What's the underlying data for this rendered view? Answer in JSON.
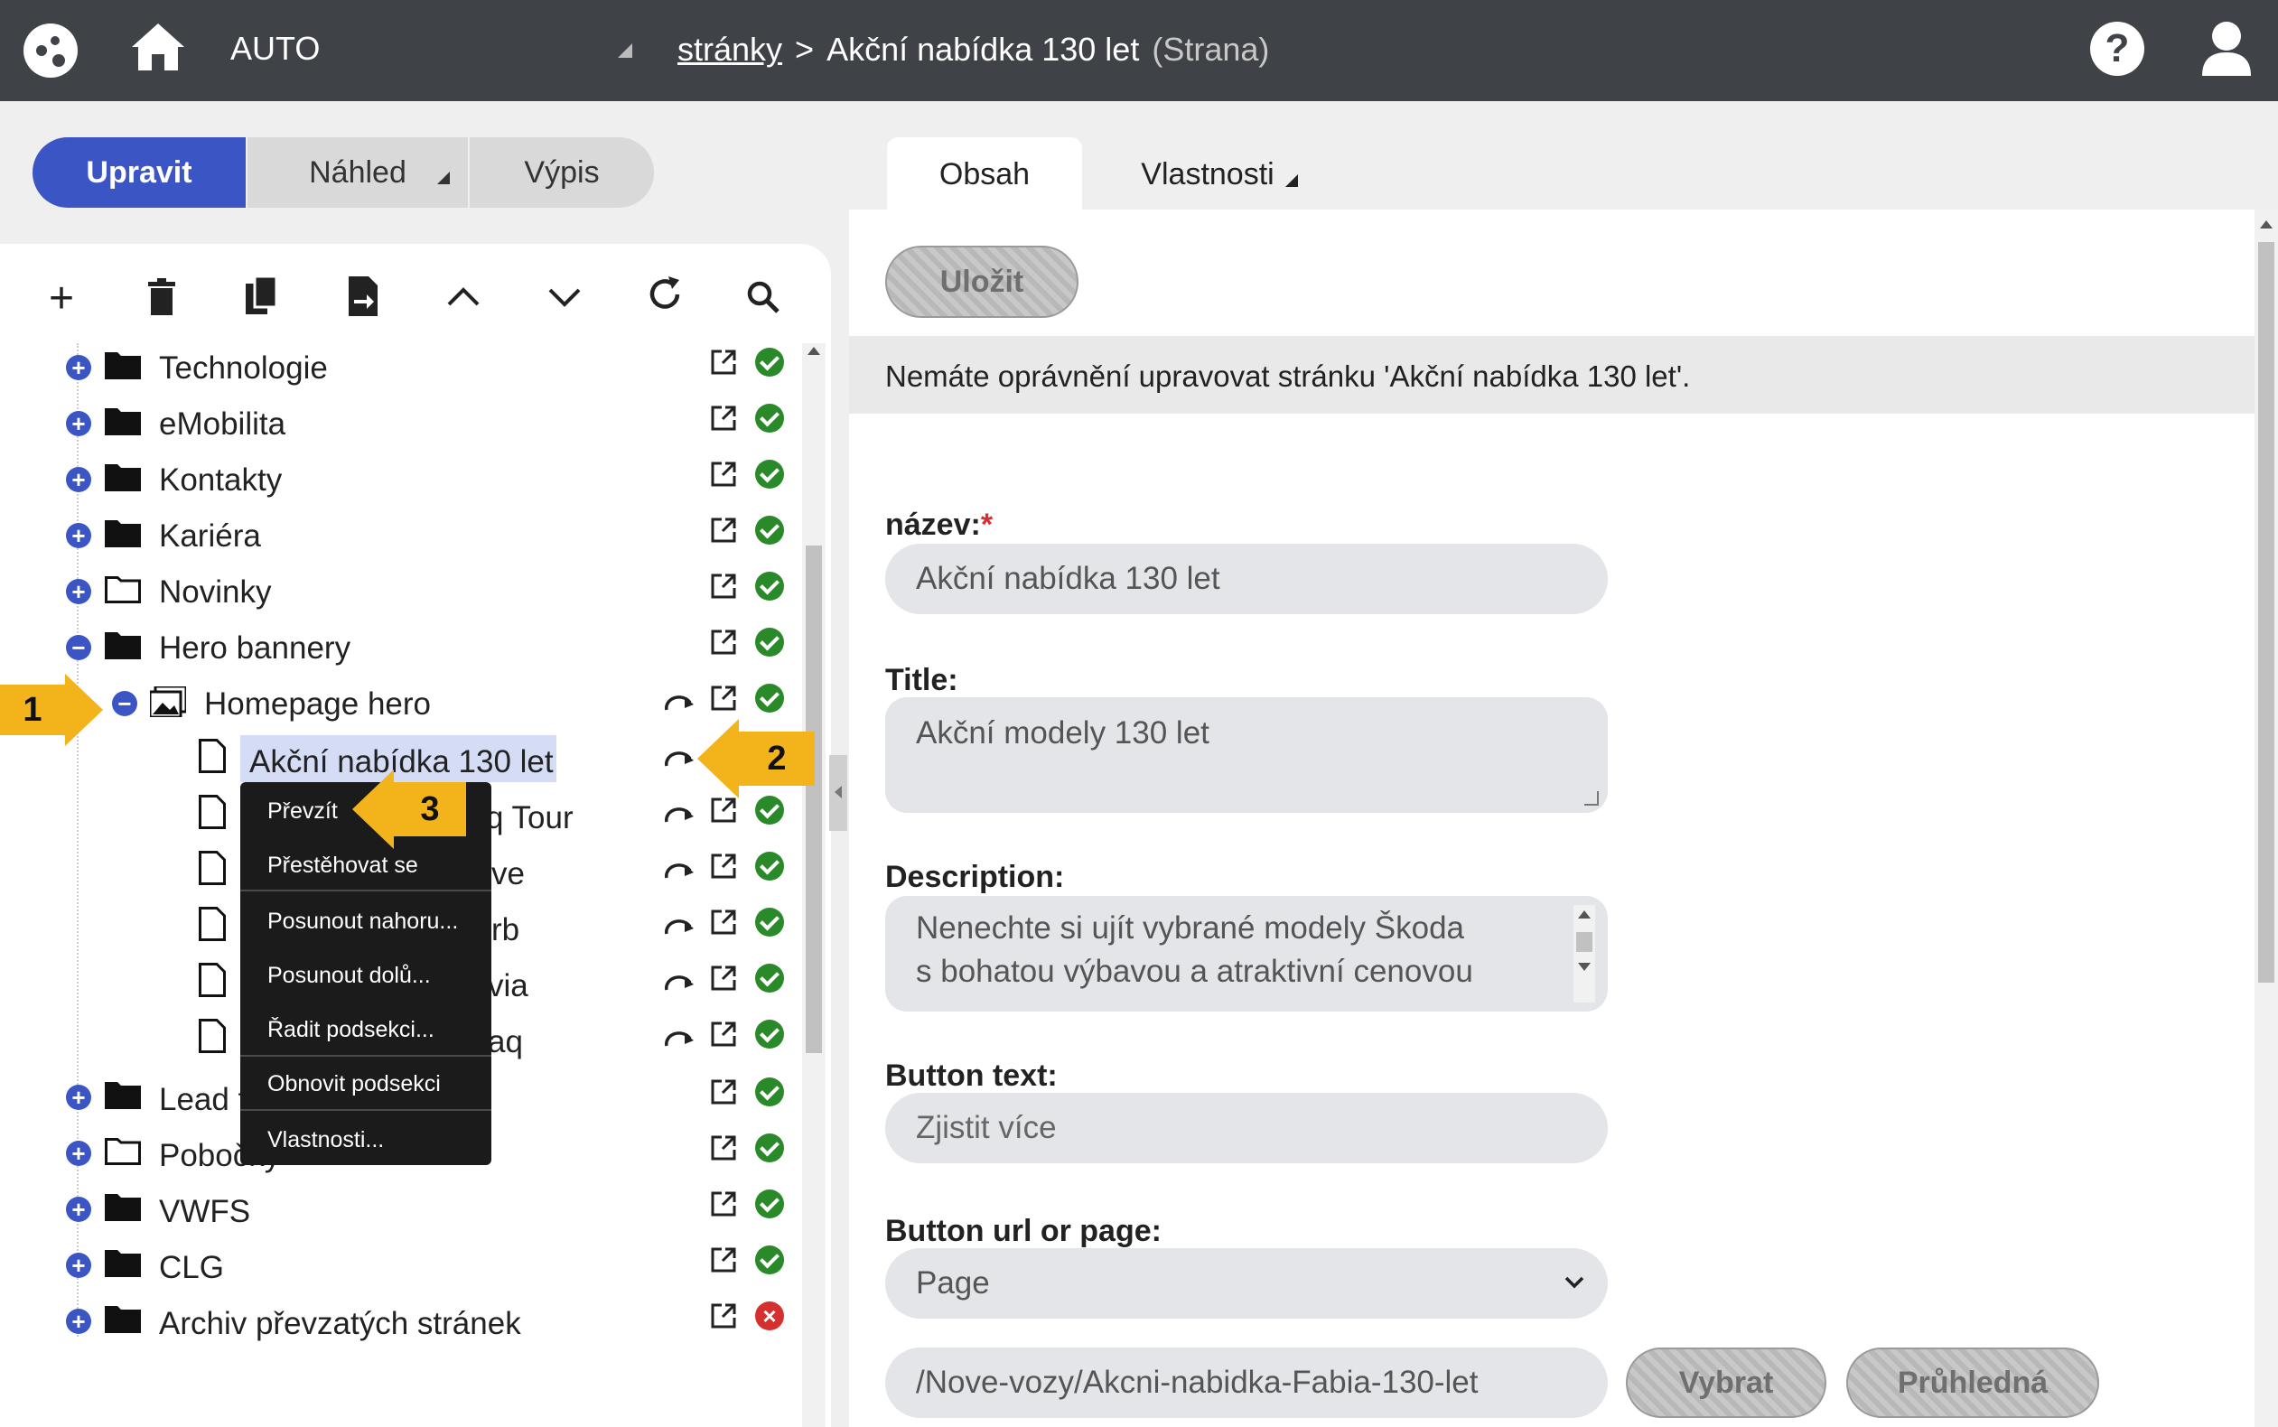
{
  "topbar": {
    "app_name": "AUTO",
    "breadcrumb_link": "stránky",
    "breadcrumb_separator": ">",
    "page_title": "Akční nabídka 130 let",
    "page_type": "(Strana)"
  },
  "view_buttons": {
    "edit": "Upravit",
    "preview": "Náhled",
    "list": "Výpis"
  },
  "tree": {
    "items": [
      {
        "label": "Technologie",
        "status": "ok"
      },
      {
        "label": "eMobilita",
        "status": "ok"
      },
      {
        "label": "Kontakty",
        "status": "ok"
      },
      {
        "label": "Kariéra",
        "status": "ok"
      },
      {
        "label": "Novinky",
        "status": "ok"
      },
      {
        "label": "Hero bannery",
        "status": "ok"
      },
      {
        "label": "Homepage hero",
        "status": "ok"
      },
      {
        "label": "Akční nabídka 130 let",
        "status": "none"
      },
      {
        "label": "q Tour",
        "status": "ok"
      },
      {
        "label": "ve",
        "status": "ok"
      },
      {
        "label": "rb",
        "status": "ok"
      },
      {
        "label": "via",
        "status": "ok"
      },
      {
        "label": "aq",
        "status": "ok"
      },
      {
        "label": "Lead f",
        "status": "ok"
      },
      {
        "label": "Pobočky",
        "status": "ok"
      },
      {
        "label": "VWFS",
        "status": "ok"
      },
      {
        "label": "CLG",
        "status": "ok"
      },
      {
        "label": "Archiv převzatých stránek",
        "status": "error"
      }
    ]
  },
  "context_menu": {
    "items": [
      "Převzít",
      "Přestěhovat se",
      "Posunout nahoru...",
      "Posunout dolů...",
      "Řadit podsekci...",
      "Obnovit podsekci",
      "Vlastnosti..."
    ]
  },
  "callouts": {
    "one": "1",
    "two": "2",
    "three": "3"
  },
  "tabs": {
    "content": "Obsah",
    "properties": "Vlastnosti"
  },
  "form": {
    "save_button": "Uložit",
    "permission_message": "Nemáte oprávnění upravovat stránku 'Akční nabídka 130 let'.",
    "name_label": "název:",
    "required_mark": "*",
    "name_value": "Akční nabídka 130 let",
    "title_label": "Title:",
    "title_value": "Akční modely 130 let",
    "description_label": "Description:",
    "description_line1": "Nenechte si ujít vybrané modely Škoda",
    "description_line2": "s bohatou výbavou a atraktivní cenovou",
    "button_text_label": "Button text:",
    "button_text_placeholder": "Zjistit více",
    "button_url_label": "Button url or page:",
    "button_url_select": "Page",
    "url_value": "/Nove-vozy/Akcni-nabidka-Fabia-130-let",
    "select_button": "Vybrat",
    "transparent_button": "Průhledná"
  },
  "colors": {
    "topbar": "#3f4247",
    "primary_blue": "#3b56c4",
    "callout": "#f3b31b",
    "ok_green": "#2a8a2a",
    "error_red": "#d62f2f"
  }
}
